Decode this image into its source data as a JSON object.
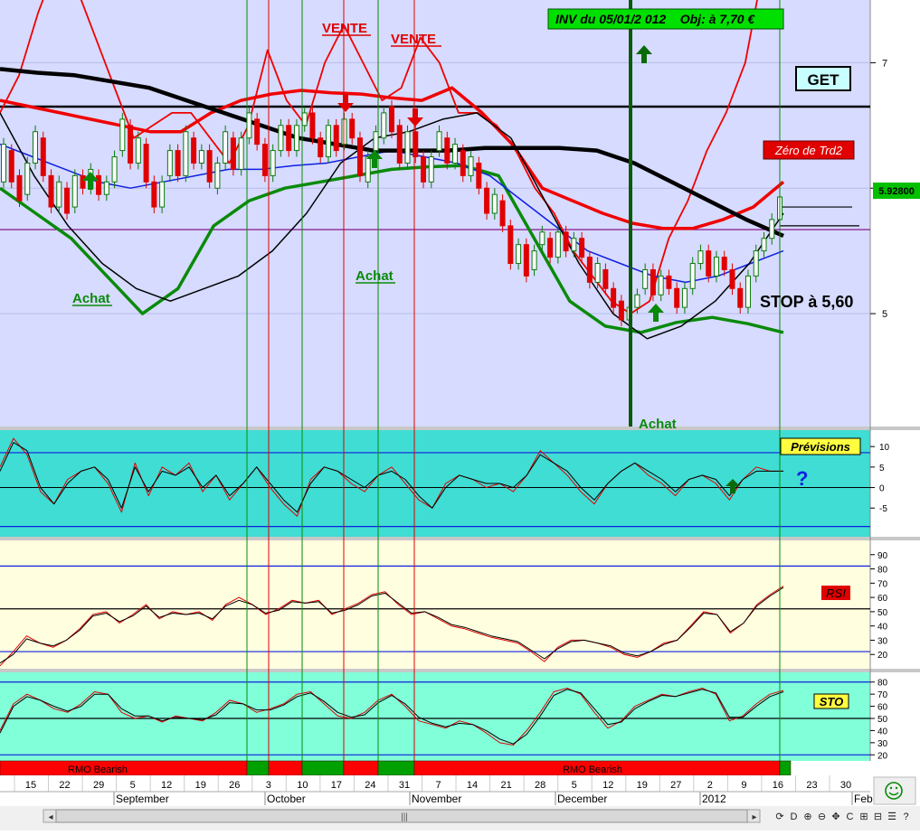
{
  "app": {
    "annotations": {
      "vente1": "VENTE",
      "vente2": "VENTE",
      "achat1": "Achat",
      "achat2": "Achat",
      "achat3": "Achat",
      "inv": "INV du 05/01/2 012    Obj: à 7,70 €",
      "get": "GET",
      "zero": "Zéro de Trd2",
      "stop": "STOP à 5,60",
      "price_tag": "5.92800",
      "question": "?"
    },
    "panels": {
      "previsions": "Prévisions",
      "rsi": "RSI",
      "sto": "STO"
    },
    "rmo": {
      "label1": "RMO Bearish",
      "label2": "RMO Bearish"
    },
    "colors": {
      "main_bg": "#D6DBFF",
      "prev_bg": "#3FDDD3",
      "rsi_bg": "#FFFFE0",
      "sto_bg": "#80FFD9",
      "rmo_red": "#FF0000",
      "rmo_green": "#00A000",
      "candle_up": "#0A7A0A",
      "candle_down": "#E00000"
    },
    "icons": [
      "smiley-icon",
      "scroll-left-icon",
      "scroll-right-icon",
      "grip-icon"
    ],
    "toolbar_symbols": [
      "⟳",
      "D",
      "⊕",
      "⊖",
      "✥",
      "C",
      "⊞",
      "⊟",
      "☰",
      "?"
    ]
  },
  "chart_data": [
    {
      "type": "candlestick",
      "ylim": [
        4.1,
        7.5
      ],
      "yticks": [
        5,
        6,
        7
      ],
      "ytick_labels": [
        "5",
        "6",
        "7"
      ],
      "last_price": 5.928,
      "horizontal_lines": [
        6.65,
        5.67
      ],
      "x_days": [
        "15",
        "22",
        "29",
        "5",
        "12",
        "19",
        "26",
        "3",
        "10",
        "17",
        "24",
        "31",
        "7",
        "14",
        "21",
        "28",
        "5",
        "12",
        "19",
        "27",
        "2",
        "9",
        "16",
        "23",
        "30"
      ],
      "x_months": [
        "September",
        "October",
        "November",
        "December",
        "2012",
        "Feb"
      ],
      "candles": [
        {
          "o": 6.05,
          "c": 6.35
        },
        {
          "o": 6.3,
          "c": 6.05
        },
        {
          "o": 6.1,
          "c": 5.9
        },
        {
          "o": 5.95,
          "c": 6.2
        },
        {
          "o": 6.2,
          "c": 6.45
        },
        {
          "o": 6.4,
          "c": 6.1
        },
        {
          "o": 6.1,
          "c": 5.85
        },
        {
          "o": 5.85,
          "c": 6.05
        },
        {
          "o": 6.0,
          "c": 5.8
        },
        {
          "o": 5.85,
          "c": 6.1
        },
        {
          "o": 6.1,
          "c": 6.0
        },
        {
          "o": 6.0,
          "c": 6.15
        },
        {
          "o": 6.1,
          "c": 5.95
        },
        {
          "o": 5.95,
          "c": 6.05
        },
        {
          "o": 6.05,
          "c": 6.25
        },
        {
          "o": 6.3,
          "c": 6.55
        },
        {
          "o": 6.5,
          "c": 6.2
        },
        {
          "o": 6.2,
          "c": 6.4
        },
        {
          "o": 6.35,
          "c": 6.05
        },
        {
          "o": 6.05,
          "c": 5.85
        },
        {
          "o": 5.85,
          "c": 6.05
        },
        {
          "o": 6.1,
          "c": 6.3
        },
        {
          "o": 6.3,
          "c": 6.1
        },
        {
          "o": 6.1,
          "c": 6.45
        },
        {
          "o": 6.4,
          "c": 6.2
        },
        {
          "o": 6.2,
          "c": 6.3
        },
        {
          "o": 6.3,
          "c": 6.05
        },
        {
          "o": 6.0,
          "c": 6.2
        },
        {
          "o": 6.2,
          "c": 6.45
        },
        {
          "o": 6.4,
          "c": 6.15
        },
        {
          "o": 6.15,
          "c": 6.4
        },
        {
          "o": 6.4,
          "c": 6.6
        },
        {
          "o": 6.55,
          "c": 6.35
        },
        {
          "o": 6.35,
          "c": 6.1
        },
        {
          "o": 6.1,
          "c": 6.3
        },
        {
          "o": 6.3,
          "c": 6.5
        },
        {
          "o": 6.5,
          "c": 6.3
        },
        {
          "o": 6.3,
          "c": 6.5
        },
        {
          "o": 6.5,
          "c": 6.6
        },
        {
          "o": 6.6,
          "c": 6.4
        },
        {
          "o": 6.4,
          "c": 6.25
        },
        {
          "o": 6.25,
          "c": 6.5
        },
        {
          "o": 6.5,
          "c": 6.3
        },
        {
          "o": 6.35,
          "c": 6.55
        },
        {
          "o": 6.55,
          "c": 6.4
        },
        {
          "o": 6.4,
          "c": 6.1
        },
        {
          "o": 6.05,
          "c": 6.25
        },
        {
          "o": 6.3,
          "c": 6.45
        },
        {
          "o": 6.4,
          "c": 6.6
        },
        {
          "o": 6.65,
          "c": 6.45
        },
        {
          "o": 6.5,
          "c": 6.2
        },
        {
          "o": 6.2,
          "c": 6.45
        },
        {
          "o": 6.45,
          "c": 6.25
        },
        {
          "o": 6.25,
          "c": 6.05
        },
        {
          "o": 6.05,
          "c": 6.25
        },
        {
          "o": 6.3,
          "c": 6.45
        },
        {
          "o": 6.4,
          "c": 6.2
        },
        {
          "o": 6.2,
          "c": 6.35
        },
        {
          "o": 6.3,
          "c": 6.1
        },
        {
          "o": 6.1,
          "c": 6.25
        },
        {
          "o": 6.2,
          "c": 6.0
        },
        {
          "o": 6.0,
          "c": 5.8
        },
        {
          "o": 5.8,
          "c": 5.95
        },
        {
          "o": 5.9,
          "c": 5.7
        },
        {
          "o": 5.7,
          "c": 5.4
        },
        {
          "o": 5.4,
          "c": 5.55
        },
        {
          "o": 5.55,
          "c": 5.3
        },
        {
          "o": 5.35,
          "c": 5.5
        },
        {
          "o": 5.55,
          "c": 5.65
        },
        {
          "o": 5.6,
          "c": 5.45
        },
        {
          "o": 5.45,
          "c": 5.65
        },
        {
          "o": 5.65,
          "c": 5.5
        },
        {
          "o": 5.5,
          "c": 5.6
        },
        {
          "o": 5.6,
          "c": 5.45
        },
        {
          "o": 5.45,
          "c": 5.25
        },
        {
          "o": 5.25,
          "c": 5.4
        },
        {
          "o": 5.35,
          "c": 5.2
        },
        {
          "o": 5.2,
          "c": 5.05
        },
        {
          "o": 5.1,
          "c": 4.95
        },
        {
          "o": 4.95,
          "c": 5.05
        },
        {
          "o": 5.05,
          "c": 5.15
        },
        {
          "o": 5.2,
          "c": 5.35
        },
        {
          "o": 5.35,
          "c": 5.15
        },
        {
          "o": 5.15,
          "c": 5.3
        },
        {
          "o": 5.3,
          "c": 5.2
        },
        {
          "o": 5.2,
          "c": 5.05
        },
        {
          "o": 5.05,
          "c": 5.2
        },
        {
          "o": 5.2,
          "c": 5.4
        },
        {
          "o": 5.4,
          "c": 5.5
        },
        {
          "o": 5.5,
          "c": 5.3
        },
        {
          "o": 5.3,
          "c": 5.45
        },
        {
          "o": 5.45,
          "c": 5.35
        },
        {
          "o": 5.35,
          "c": 5.2
        },
        {
          "o": 5.2,
          "c": 5.05
        },
        {
          "o": 5.05,
          "c": 5.3
        },
        {
          "o": 5.3,
          "c": 5.5
        },
        {
          "o": 5.5,
          "c": 5.6
        },
        {
          "o": 5.6,
          "c": 5.75
        },
        {
          "o": 5.75,
          "c": 5.93
        }
      ],
      "series": [
        {
          "values": [
            6.6,
            6.9,
            7.4,
            7.8,
            7.6,
            7.2,
            6.8,
            6.4,
            6.5,
            6.6,
            6.6,
            6.4,
            6.2,
            6.5,
            7.1,
            6.7,
            6.5,
            7.0,
            7.3,
            7.0,
            6.7,
            6.8,
            7.2,
            7.0,
            6.6,
            6.6,
            6.5,
            6.3,
            6.0,
            5.8,
            5.5,
            5.3,
            5.1,
            5.0,
            5.1,
            5.6,
            5.9,
            6.3,
            6.6,
            7.0,
            7.8,
            7.9
          ]
        },
        {
          "values": [
            6.7,
            6.65,
            6.6,
            6.55,
            6.5,
            6.45,
            6.45,
            6.6,
            6.7,
            6.75,
            6.78,
            6.76,
            6.75,
            6.72,
            6.7,
            6.8,
            6.6,
            6.35,
            6.0,
            5.9,
            5.8,
            5.72,
            5.68,
            5.68,
            5.75,
            5.85,
            6.05
          ]
        },
        {
          "values": [
            6.0,
            5.8,
            5.6,
            5.3,
            5.0,
            5.2,
            5.7,
            5.9,
            6.0,
            6.05,
            6.1,
            6.15,
            6.17,
            6.18,
            6.1,
            5.6,
            5.1,
            4.9,
            4.85,
            4.93,
            4.97,
            4.92,
            4.85
          ]
        },
        {
          "values": [
            6.35,
            6.25,
            6.15,
            6.05,
            6.0,
            6.05,
            6.1,
            6.15,
            6.15,
            6.18,
            6.2,
            6.25,
            6.3,
            6.25,
            6.2,
            6.1,
            5.9,
            5.7,
            5.5,
            5.4,
            5.3,
            5.25,
            5.3,
            5.4,
            5.5
          ]
        },
        {
          "values": [
            6.6,
            6.1,
            5.7,
            5.4,
            5.2,
            5.1,
            5.2,
            5.3,
            5.5,
            5.8,
            6.2,
            6.4,
            6.45,
            6.55,
            6.6,
            6.4,
            5.9,
            5.4,
            5.0,
            4.8,
            4.9,
            5.1,
            5.4,
            5.8
          ]
        },
        {
          "values": [
            6.95,
            6.92,
            6.9,
            6.85,
            6.8,
            6.7,
            6.6,
            6.5,
            6.4,
            6.35,
            6.3,
            6.3,
            6.3,
            6.32,
            6.32,
            6.32,
            6.3,
            6.2,
            6.05,
            5.9,
            5.75,
            5.62
          ]
        }
      ]
    },
    {
      "type": "line",
      "ylim": [
        -12,
        14
      ],
      "yticks": [
        -5,
        0,
        5,
        10
      ],
      "series": [
        {
          "values": [
            5,
            12,
            8,
            -1,
            -4,
            2,
            4,
            5,
            1,
            -6,
            6,
            -2,
            5,
            3,
            6,
            -1,
            3,
            -3,
            1,
            5,
            0,
            -4,
            -7,
            2,
            5,
            4,
            1,
            -1,
            3,
            5,
            1,
            -3,
            -5,
            1,
            3,
            2,
            0,
            1,
            -1,
            3,
            9,
            6,
            3,
            -1,
            -4,
            1,
            4,
            6,
            3,
            1,
            -2,
            2,
            3,
            1,
            -3,
            2,
            5,
            4,
            4
          ]
        },
        {
          "values": [
            4,
            11,
            9,
            0,
            -4,
            1,
            4,
            5,
            2,
            -5,
            5,
            -1,
            4,
            3,
            5,
            0,
            3,
            -2,
            1,
            5,
            1,
            -3,
            -6,
            1,
            5,
            4,
            2,
            0,
            3,
            4,
            2,
            -2,
            -5,
            0,
            3,
            2,
            1,
            1,
            0,
            3,
            8,
            6,
            4,
            0,
            -3,
            1,
            4,
            6,
            4,
            2,
            -1,
            2,
            3,
            2,
            -2,
            2,
            4,
            4,
            4
          ]
        }
      ]
    },
    {
      "type": "line",
      "ylim": [
        10,
        100
      ],
      "yticks": [
        20,
        30,
        40,
        50,
        60,
        70,
        80,
        90
      ],
      "hlines": [
        22,
        52,
        82
      ],
      "series": [
        {
          "values": [
            12,
            22,
            33,
            28,
            25,
            30,
            38,
            48,
            50,
            42,
            48,
            55,
            45,
            50,
            48,
            50,
            44,
            55,
            60,
            55,
            48,
            52,
            58,
            56,
            58,
            48,
            52,
            56,
            62,
            64,
            55,
            48,
            50,
            45,
            40,
            38,
            35,
            32,
            30,
            28,
            22,
            15,
            25,
            30,
            30,
            28,
            25,
            20,
            18,
            22,
            28,
            30,
            40,
            50,
            48,
            35,
            42,
            55,
            62,
            68
          ]
        },
        {
          "values": [
            14,
            20,
            31,
            28,
            26,
            30,
            37,
            47,
            49,
            43,
            47,
            54,
            46,
            49,
            48,
            49,
            45,
            54,
            58,
            55,
            49,
            51,
            57,
            56,
            57,
            49,
            51,
            55,
            61,
            63,
            56,
            49,
            50,
            46,
            41,
            39,
            36,
            33,
            31,
            29,
            23,
            17,
            24,
            29,
            30,
            28,
            26,
            21,
            19,
            22,
            27,
            30,
            39,
            49,
            48,
            36,
            42,
            54,
            61,
            67
          ]
        }
      ]
    },
    {
      "type": "line",
      "ylim": [
        15,
        88
      ],
      "yticks": [
        20,
        30,
        40,
        50,
        60,
        70,
        80
      ],
      "hlines": [
        20,
        50,
        80
      ],
      "series": [
        {
          "values": [
            40,
            62,
            70,
            65,
            58,
            55,
            62,
            72,
            70,
            55,
            50,
            52,
            47,
            52,
            50,
            48,
            55,
            65,
            62,
            55,
            58,
            62,
            70,
            72,
            62,
            52,
            50,
            55,
            65,
            70,
            60,
            48,
            45,
            42,
            48,
            45,
            38,
            30,
            28,
            40,
            55,
            72,
            75,
            70,
            55,
            42,
            48,
            60,
            65,
            70,
            68,
            72,
            75,
            70,
            48,
            52,
            62,
            70,
            73
          ]
        },
        {
          "values": [
            38,
            60,
            68,
            65,
            60,
            56,
            60,
            70,
            70,
            58,
            52,
            52,
            48,
            51,
            50,
            49,
            53,
            63,
            62,
            57,
            57,
            61,
            68,
            71,
            64,
            55,
            51,
            53,
            63,
            69,
            62,
            51,
            46,
            43,
            46,
            45,
            40,
            33,
            29,
            37,
            52,
            69,
            74,
            71,
            58,
            45,
            47,
            58,
            64,
            69,
            68,
            71,
            74,
            71,
            51,
            51,
            60,
            68,
            72
          ]
        }
      ]
    }
  ]
}
